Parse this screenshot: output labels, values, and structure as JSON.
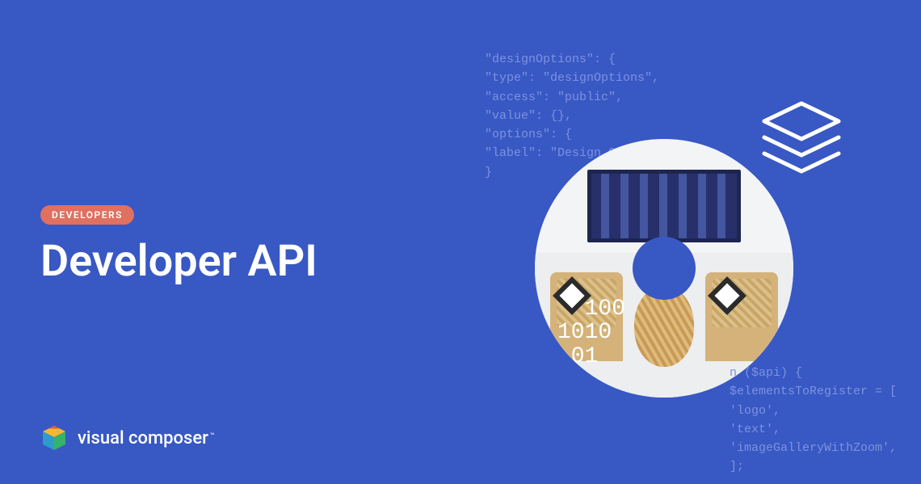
{
  "badge": {
    "label": "DEVELOPERS"
  },
  "title": "Developer API",
  "brand": {
    "name": "visual composer",
    "trademark": "™"
  },
  "code_top": "\"designOptions\": {\n\"type\": \"designOptions\",\n\"access\": \"public\",\n\"value\": {},\n\"options\": {\n\"label\": \"Design Opti\n}",
  "code_bottom": "n ($api) {\n$elementsToRegister = [\n'logo',\n'text',\n'imageGalleryWithZoom',\n];",
  "binary": "  100\n1010\n 01",
  "icons": {
    "layers": "layers-icon",
    "logo": "visual-composer-cube-icon"
  },
  "colors": {
    "background": "#3858c4",
    "badge": "#e07060",
    "code": "#7c92df",
    "white": "#ffffff"
  }
}
